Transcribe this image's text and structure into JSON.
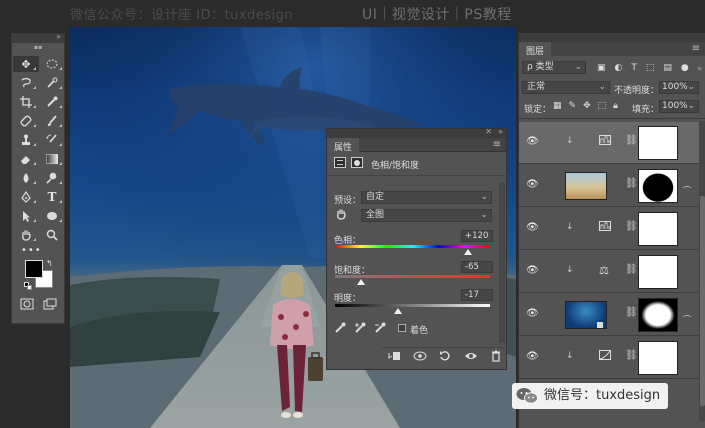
{
  "top_watermark": "微信公众号：设计座  ID：tuxdesign",
  "header_right": "UI｜视觉设计｜PS教程",
  "properties": {
    "tab": "属性",
    "title": "色相/饱和度",
    "preset_label": "预设：",
    "preset_value": "自定",
    "channel_value": "全图",
    "hue_label": "色相：",
    "hue_value": "+120",
    "saturation_label": "饱和度：",
    "saturation_value": "-65",
    "lightness_label": "明度：",
    "lightness_value": "-17",
    "colorize_label": "着色"
  },
  "layers": {
    "tab": "图层",
    "filter_label": "ρ 类型",
    "blend_mode": "正常",
    "opacity_label": "不透明度：",
    "opacity_value": "100%",
    "lock_label": "锁定：",
    "fill_label": "填充：",
    "fill_value": "100%"
  },
  "watermark_bottom": "微信号：tuxdesign",
  "colors": {
    "hue_slider": [
      "#ff0000",
      "#ffff00",
      "#00ff00",
      "#00ffff",
      "#0000ff",
      "#ff00ff",
      "#ff0000"
    ],
    "saturation_slider": [
      "#7a7a7a",
      "#ff2a2a"
    ],
    "lightness_slider": [
      "#000000",
      "#ffffff"
    ],
    "panel": "#535353"
  }
}
